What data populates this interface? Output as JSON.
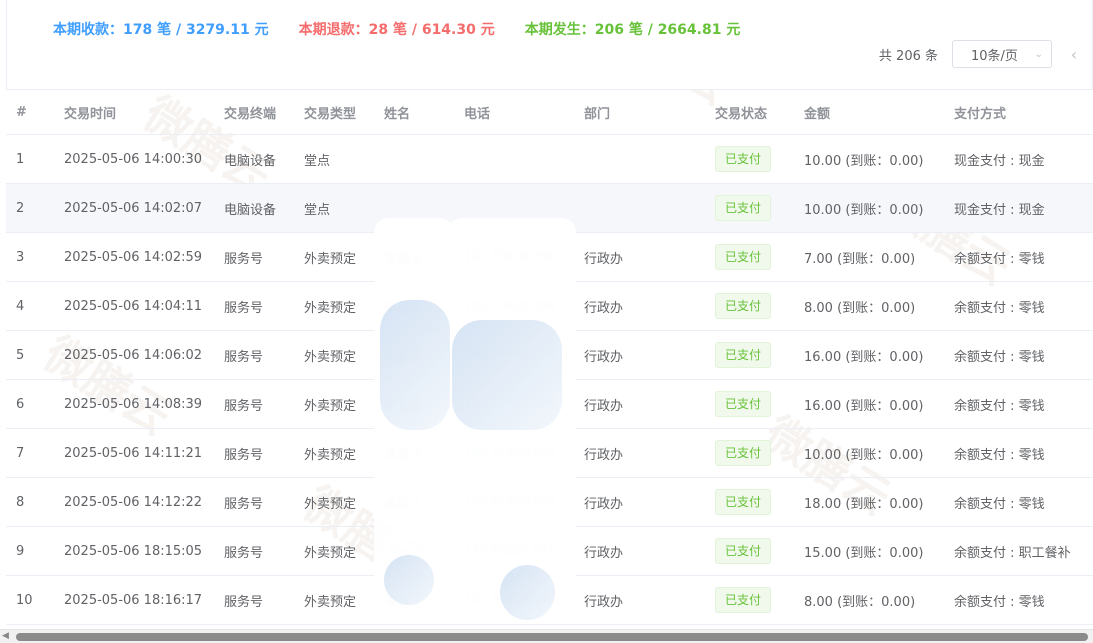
{
  "summary": {
    "received": "本期收款：178 笔 / 3279.11 元",
    "refund": "本期退款：28 笔 / 614.30 元",
    "occurred": "本期发生：206 笔 / 2664.81 元"
  },
  "pager": {
    "total": "共 206 条",
    "page_size": "10条/页",
    "prev_icon": "chevron-left-icon"
  },
  "watermark": "微膳云",
  "colors": {
    "blue": "#409eff",
    "red": "#f56c6c",
    "green": "#67c23a",
    "header_text": "#909399",
    "stripe": "#f5f7fa"
  },
  "table": {
    "headers": [
      "#",
      "交易时间",
      "交易终端",
      "交易类型",
      "姓名",
      "电话",
      "部门",
      "交易状态",
      "金额",
      "支付方式"
    ],
    "rows": [
      {
        "idx": "1",
        "time": "2025-05-06 14:00:30",
        "terminal": "电脑设备",
        "type": "堂点",
        "name": "",
        "phone": "",
        "dept": "",
        "status": "已支付",
        "amount": "10.00 (到账：0.00)",
        "pay": "现金支付 : 现金"
      },
      {
        "idx": "2",
        "time": "2025-05-06 14:02:07",
        "terminal": "电脑设备",
        "type": "堂点",
        "name": "",
        "phone": "",
        "dept": "",
        "status": "已支付",
        "amount": "10.00 (到账：0.00)",
        "pay": "现金支付 : 现金"
      },
      {
        "idx": "3",
        "time": "2025-05-06 14:02:59",
        "terminal": "服务号",
        "type": "外卖预定",
        "name": "黄露玉",
        "phone": "18275938399",
        "dept": "行政办",
        "status": "已支付",
        "amount": "7.00 (到账：0.00)",
        "pay": "余额支付 : 零钱"
      },
      {
        "idx": "4",
        "time": "2025-05-06 14:04:11",
        "terminal": "服务号",
        "type": "外卖预定",
        "name": "黄露玉",
        "phone": "18275938399",
        "dept": "行政办",
        "status": "已支付",
        "amount": "8.00 (到账：0.00)",
        "pay": "余额支付 : 零钱"
      },
      {
        "idx": "5",
        "time": "2025-05-06 14:06:02",
        "terminal": "服务号",
        "type": "外卖预定",
        "name": "黄露玉",
        "phone": "18275938399",
        "dept": "行政办",
        "status": "已支付",
        "amount": "16.00 (到账：0.00)",
        "pay": "余额支付 : 零钱"
      },
      {
        "idx": "6",
        "time": "2025-05-06 14:08:39",
        "terminal": "服务号",
        "type": "外卖预定",
        "name": "黄露玉",
        "phone": "18275938399",
        "dept": "行政办",
        "status": "已支付",
        "amount": "16.00 (到账：0.00)",
        "pay": "余额支付 : 零钱"
      },
      {
        "idx": "7",
        "time": "2025-05-06 14:11:21",
        "terminal": "服务号",
        "type": "外卖预定",
        "name": "黄露玉",
        "phone": "18275938399",
        "dept": "行政办",
        "status": "已支付",
        "amount": "10.00 (到账：0.00)",
        "pay": "余额支付 : 零钱"
      },
      {
        "idx": "8",
        "time": "2025-05-06 14:12:22",
        "terminal": "服务号",
        "type": "外卖预定",
        "name": "黄露玉",
        "phone": "18275938399",
        "dept": "行政办",
        "status": "已支付",
        "amount": "18.00 (到账：0.00)",
        "pay": "余额支付 : 零钱"
      },
      {
        "idx": "9",
        "time": "2025-05-06 18:15:05",
        "terminal": "服务号",
        "type": "外卖预定",
        "name": "十一",
        "phone": "15578887397",
        "dept": "行政办",
        "status": "已支付",
        "amount": "15.00 (到账：0.00)",
        "pay": "余额支付 : 职工餐补"
      },
      {
        "idx": "10",
        "time": "2025-05-06 18:16:17",
        "terminal": "服务号",
        "type": "外卖预定",
        "name": "黄露玉",
        "phone": "18275938399",
        "dept": "行政办",
        "status": "已支付",
        "amount": "8.00 (到账：0.00)",
        "pay": "余额支付 : 零钱"
      }
    ]
  }
}
